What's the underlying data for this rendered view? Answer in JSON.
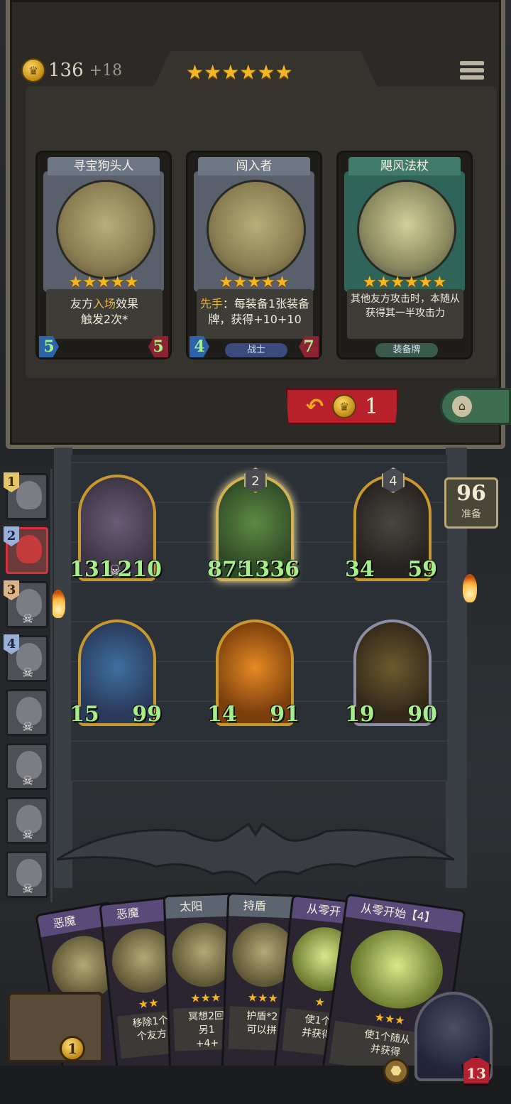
{
  "top": {
    "gold": "136",
    "gold_bonus": "+18",
    "stars": "★★★★★★",
    "menu_icon": "menu-icon"
  },
  "shop_cards": [
    {
      "name": "寻宝狗头人",
      "desc_pre": "友方",
      "desc_hl": "入场",
      "desc_post": "效果\n触发2次*",
      "attack": "5",
      "health": "5",
      "stars": "★★★★★",
      "tribe": ""
    },
    {
      "name": "闯入者",
      "desc_hl": "先手",
      "desc_post": "：每装备1张装备牌，获得+10+10",
      "attack": "4",
      "health": "7",
      "stars": "★★★★★",
      "tribe": "战士"
    },
    {
      "name": "飓风法杖",
      "desc_post": "其他友方攻击时，本随从获得其一半攻击力",
      "attack": "",
      "health": "",
      "stars": "★★★★★★",
      "tribe": "装备牌"
    }
  ],
  "refresh": {
    "arrow": "↶",
    "cost": "1"
  },
  "lock": {
    "icon": "lock-icon",
    "glyph": "🔒"
  },
  "ready": {
    "count": "96",
    "label": "准备"
  },
  "board": [
    {
      "attack": "131",
      "health": "210",
      "level": "",
      "skull": "☠"
    },
    {
      "attack": "875",
      "health": "1336",
      "level": "2",
      "skull": ""
    },
    {
      "attack": "34",
      "health": "59",
      "level": "4",
      "skull": ""
    },
    {
      "attack": "15",
      "health": "99",
      "level": "",
      "skull": ""
    },
    {
      "attack": "14",
      "health": "91",
      "level": "",
      "skull": ""
    },
    {
      "attack": "19",
      "health": "90",
      "level": "",
      "skull": ""
    }
  ],
  "sidebar": [
    {
      "rank": "1",
      "skull": ""
    },
    {
      "rank": "2",
      "skull": ""
    },
    {
      "rank": "3",
      "skull": "☠"
    },
    {
      "rank": "4",
      "skull": "☠"
    },
    {
      "rank": "",
      "skull": "☠"
    },
    {
      "rank": "",
      "skull": "☠"
    },
    {
      "rank": "",
      "skull": "☠"
    },
    {
      "rank": "",
      "skull": "☠"
    }
  ],
  "hand": [
    {
      "title": "恶魔",
      "desc": "",
      "stars": ""
    },
    {
      "title": "恶魔",
      "desc": "移除1个\n个友方",
      "stars": "★★"
    },
    {
      "title": "太阳",
      "desc": "冥想2回\n另1\n+4+",
      "stars": "★★★"
    },
    {
      "title": "持盾",
      "desc": "护盾*2\n可以拼",
      "stars": "★★★"
    },
    {
      "title": "从零开",
      "desc": "使1个\n并获得",
      "stars": "★"
    },
    {
      "title": "从零开始【4】",
      "desc": "使1个随从\n并获得",
      "stars": "★★★"
    }
  ],
  "chest_coin": "1",
  "hero": {
    "health": "13",
    "power_icon": "shield-icon",
    "power_glyph": "⬣"
  }
}
